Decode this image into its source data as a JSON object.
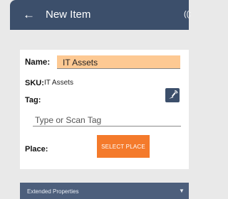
{
  "header": {
    "title": "New Item",
    "back_icon": "←",
    "edge_icon": "((:"
  },
  "form": {
    "name_label": "Name:",
    "name_value": "IT Assets",
    "sku_label": "SKU:",
    "sku_value": "IT Assets",
    "tag_label": "Tag:",
    "tag_placeholder": "Type or Scan Tag",
    "place_label": "Place:",
    "select_place_label": "SELECT PLACE"
  },
  "extended": {
    "label": "Extended Properties",
    "caret": "▼"
  },
  "colors": {
    "header": "#3c4f6b",
    "accent_orange": "#f47a2b",
    "name_highlight": "#fdc993",
    "ext_bar": "#4d5f7c"
  },
  "icons": {
    "back": "back-arrow-icon",
    "scan": "scan-tag-icon",
    "edge": "partial-header-icon",
    "caret": "chevron-down-icon"
  }
}
